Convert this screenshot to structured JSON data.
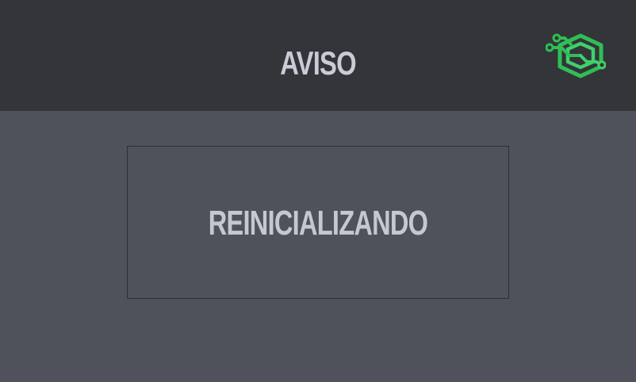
{
  "header": {
    "title": "AVISO",
    "logo_icon": "circuit-hexagon-logo-icon",
    "logo_color": "#34c759"
  },
  "message": {
    "text": "REINICIALIZANDO"
  },
  "colors": {
    "header_background": "#333539",
    "page_background": "#4f525a",
    "text": "#c9ccd6",
    "box_border": "#2d2f33"
  }
}
